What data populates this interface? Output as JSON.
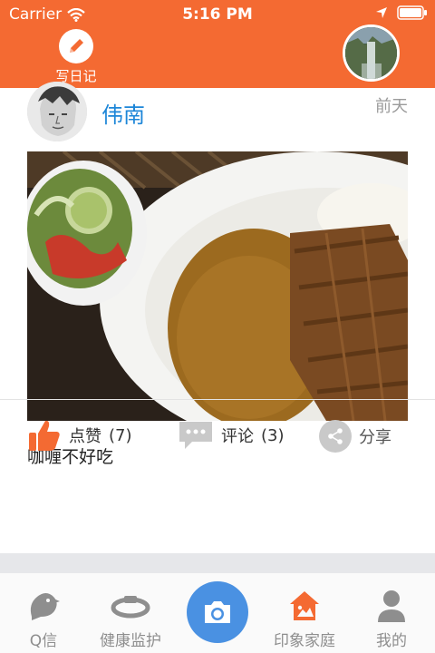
{
  "status_bar": {
    "carrier": "Carrier",
    "time": "5:16 PM",
    "icons": [
      "wifi-icon",
      "location-arrow-icon",
      "battery-icon"
    ]
  },
  "nav": {
    "write_label": "写日记",
    "accent_color": "#f46a32"
  },
  "post": {
    "author": "伟南",
    "time": "前天",
    "caption": "咖喱不好吃"
  },
  "actions": {
    "like_label": "点赞",
    "like_count": "(7)",
    "comment_label": "评论",
    "comment_count": "(3)",
    "share_label": "分享"
  },
  "tabs": [
    {
      "label": "Q信",
      "icon": "chat-bird-icon"
    },
    {
      "label": "健康监护",
      "icon": "wristband-icon"
    },
    {
      "label": "",
      "icon": "camera-icon"
    },
    {
      "label": "印象家庭",
      "icon": "house-picture-icon",
      "active": true
    },
    {
      "label": "我的",
      "icon": "person-icon"
    }
  ]
}
